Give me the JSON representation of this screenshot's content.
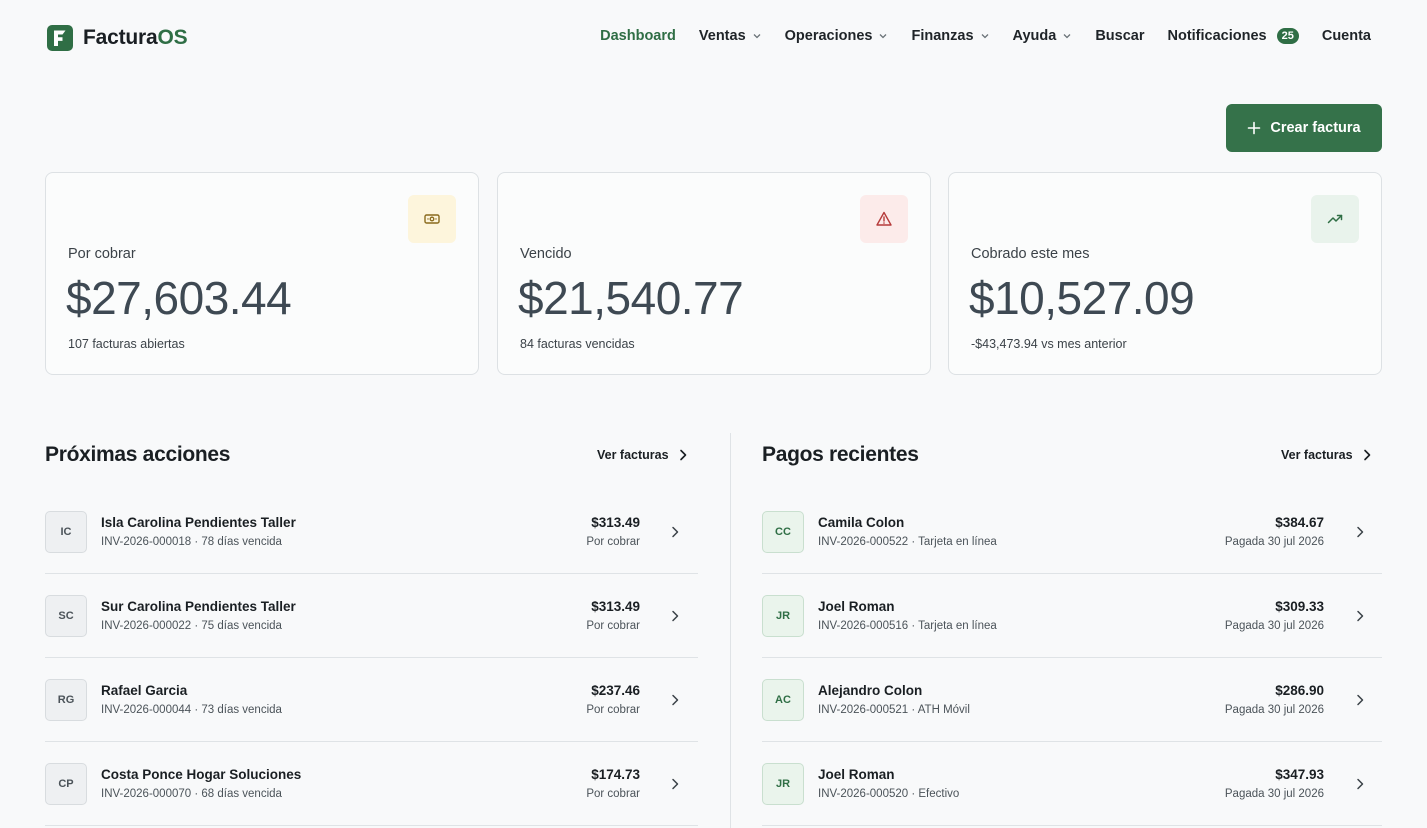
{
  "brand": {
    "name_main": "Factura",
    "name_accent": "OS"
  },
  "nav": {
    "items": [
      {
        "label": "Dashboard",
        "active": true,
        "dropdown": false
      },
      {
        "label": "Ventas",
        "dropdown": true
      },
      {
        "label": "Operaciones",
        "dropdown": true
      },
      {
        "label": "Finanzas",
        "dropdown": true
      },
      {
        "label": "Ayuda",
        "dropdown": true
      },
      {
        "label": "Buscar",
        "dropdown": false
      }
    ],
    "notifications_label": "Notificaciones",
    "notifications_count": "25",
    "account_label": "Cuenta"
  },
  "cta": {
    "label": "Crear factura",
    "icon": "plus-icon"
  },
  "stats": [
    {
      "label": "Por cobrar",
      "value": "$27,603.44",
      "sub": "107 facturas abiertas",
      "icon": "banknote-icon",
      "icon_bg": "#fdf5dc",
      "icon_color": "#8a6a1d"
    },
    {
      "label": "Vencido",
      "value": "$21,540.77",
      "sub": "84 facturas vencidas",
      "icon": "alert-triangle-icon",
      "icon_bg": "#fcebea",
      "icon_color": "#b53a3a"
    },
    {
      "label": "Cobrado este mes",
      "value": "$10,527.09",
      "sub": "-$43,473.94 vs mes anterior",
      "icon": "trending-up-icon",
      "icon_bg": "#e9f3ec",
      "icon_color": "#2f6e45"
    }
  ],
  "next_actions": {
    "title": "Próximas acciones",
    "link_label": "Ver facturas",
    "rows": [
      {
        "initials": "IC",
        "name": "Isla Carolina Pendientes Taller",
        "meta": "INV-2026-000018 · 78 días vencida",
        "amount": "$313.49",
        "status": "Por cobrar"
      },
      {
        "initials": "SC",
        "name": "Sur Carolina Pendientes Taller",
        "meta": "INV-2026-000022 · 75 días vencida",
        "amount": "$313.49",
        "status": "Por cobrar"
      },
      {
        "initials": "RG",
        "name": "Rafael Garcia",
        "meta": "INV-2026-000044 · 73 días vencida",
        "amount": "$237.46",
        "status": "Por cobrar"
      },
      {
        "initials": "CP",
        "name": "Costa Ponce Hogar Soluciones",
        "meta": "INV-2026-000070 · 68 días vencida",
        "amount": "$174.73",
        "status": "Por cobrar"
      }
    ]
  },
  "recent_payments": {
    "title": "Pagos recientes",
    "link_label": "Ver facturas",
    "rows": [
      {
        "initials": "CC",
        "name": "Camila Colon",
        "meta": "INV-2026-000522 · Tarjeta en línea",
        "amount": "$384.67",
        "status": "Pagada 30 jul 2026"
      },
      {
        "initials": "JR",
        "name": "Joel Roman",
        "meta": "INV-2026-000516 · Tarjeta en línea",
        "amount": "$309.33",
        "status": "Pagada 30 jul 2026"
      },
      {
        "initials": "AC",
        "name": "Alejandro Colon",
        "meta": "INV-2026-000521 · ATH Móvil",
        "amount": "$286.90",
        "status": "Pagada 30 jul 2026"
      },
      {
        "initials": "JR",
        "name": "Joel Roman",
        "meta": "INV-2026-000520 · Efectivo",
        "amount": "$347.93",
        "status": "Pagada 30 jul 2026"
      }
    ]
  },
  "colors": {
    "brand": "#2f6e45",
    "text": "#1a1f23",
    "muted": "#4b5359",
    "border": "#dfe3e6"
  }
}
